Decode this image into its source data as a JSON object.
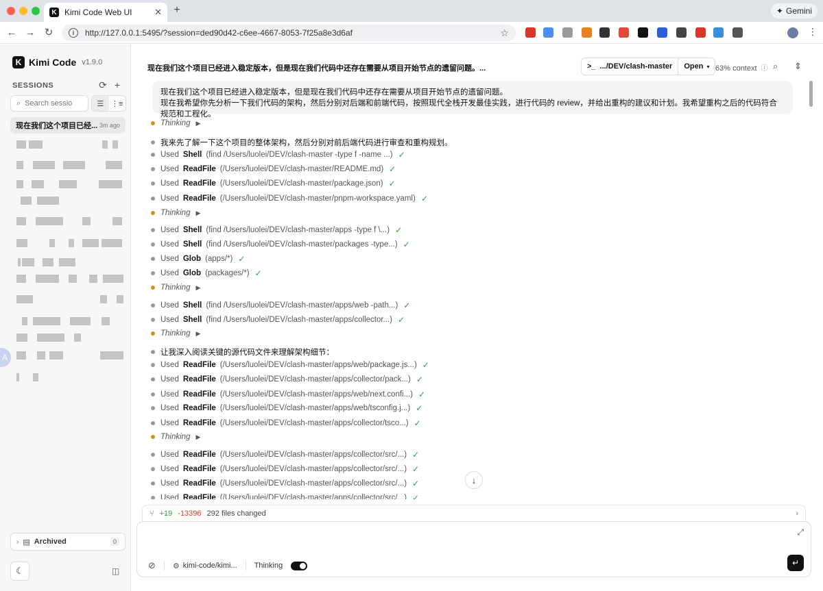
{
  "browser": {
    "tab_title": "Kimi Code Web UI",
    "tab_favicon": "K",
    "new_tab": "+",
    "gemini_label": "Gemini",
    "url": "http://127.0.0.1:5495/?session=ded90d42-c6ee-4667-8053-7f25a8e3d6af",
    "extension_colors": [
      "#d9362b",
      "#4a8ef0",
      "#9a9a9a",
      "#e8821e",
      "#333333",
      "#e04a3a",
      "#111111",
      "#2f5fd6",
      "#444444",
      "#d9362b",
      "#3a8fd9",
      "#555555"
    ]
  },
  "sidebar": {
    "brand_logo": "K",
    "brand_name": "Kimi Code",
    "version": "v1.9.0",
    "sessions_label": "SESSIONS",
    "search_placeholder": "Search sessio",
    "active_session": {
      "title": "现在我们这个项目已经...",
      "time": "3m ago"
    },
    "avatar_letter": "A",
    "archived_label": "Archived",
    "archived_count": "0"
  },
  "main": {
    "title": "现在我们这个项目已经进入稳定版本，但是现在我们代码中还存在需要从项目开始节点的遗留问题。...",
    "cwd": ".../DEV/clash-master",
    "open_label": "Open",
    "context": "63% context",
    "user_message": [
      "现在我们这个项目已经进入稳定版本，但是现在我们代码中还存在需要从项目开始节点的遗留问题。",
      "现在我希望你先分析一下我们代码的架构，然后分别对后端和前端代码，按照现代全栈开发最佳实践，进行代码的 review，并给出重构的建议和计划。我希望重构之后的代码符合规范和工程化。"
    ],
    "thinking_label": "Thinking",
    "used_label": "Used",
    "steps": [
      {
        "kind": "thinking"
      },
      {
        "kind": "say",
        "text": "我来先了解一下这个项目的整体架构，然后分别对前后端代码进行审查和重构规划。"
      },
      {
        "kind": "tool",
        "tool": "Shell",
        "args": "(find /Users/luolei/DEV/clash-master -type f -name ...)"
      },
      {
        "kind": "tool",
        "tool": "ReadFile",
        "args": "(/Users/luolei/DEV/clash-master/README.md)"
      },
      {
        "kind": "tool",
        "tool": "ReadFile",
        "args": "(/Users/luolei/DEV/clash-master/package.json)"
      },
      {
        "kind": "tool",
        "tool": "ReadFile",
        "args": "(/Users/luolei/DEV/clash-master/pnpm-workspace.yaml)"
      },
      {
        "kind": "thinking"
      },
      {
        "kind": "tool",
        "tool": "Shell",
        "args": "(find /Users/luolei/DEV/clash-master/apps -type f \\...)"
      },
      {
        "kind": "tool",
        "tool": "Shell",
        "args": "(find /Users/luolei/DEV/clash-master/packages -type...)"
      },
      {
        "kind": "tool",
        "tool": "Glob",
        "args": "(apps/*)"
      },
      {
        "kind": "tool",
        "tool": "Glob",
        "args": "(packages/*)"
      },
      {
        "kind": "thinking"
      },
      {
        "kind": "tool",
        "tool": "Shell",
        "args": "(find /Users/luolei/DEV/clash-master/apps/web -path...)"
      },
      {
        "kind": "tool",
        "tool": "Shell",
        "args": "(find /Users/luolei/DEV/clash-master/apps/collector...)"
      },
      {
        "kind": "thinking"
      },
      {
        "kind": "say",
        "text": "让我深入阅读关键的源代码文件来理解架构细节："
      },
      {
        "kind": "tool",
        "tool": "ReadFile",
        "args": "(/Users/luolei/DEV/clash-master/apps/web/package.js...)"
      },
      {
        "kind": "tool",
        "tool": "ReadFile",
        "args": "(/Users/luolei/DEV/clash-master/apps/collector/pack...)"
      },
      {
        "kind": "tool",
        "tool": "ReadFile",
        "args": "(/Users/luolei/DEV/clash-master/apps/web/next.confi...)"
      },
      {
        "kind": "tool",
        "tool": "ReadFile",
        "args": "(/Users/luolei/DEV/clash-master/apps/web/tsconfig.j...)"
      },
      {
        "kind": "tool",
        "tool": "ReadFile",
        "args": "(/Users/luolei/DEV/clash-master/apps/collector/tsco...)"
      },
      {
        "kind": "thinking"
      },
      {
        "kind": "tool",
        "tool": "ReadFile",
        "args": "(/Users/luolei/DEV/clash-master/apps/collector/src/...)"
      },
      {
        "kind": "tool",
        "tool": "ReadFile",
        "args": "(/Users/luolei/DEV/clash-master/apps/collector/src/...)"
      },
      {
        "kind": "tool",
        "tool": "ReadFile",
        "args": "(/Users/luolei/DEV/clash-master/apps/collector/src/...)"
      },
      {
        "kind": "tool",
        "tool": "ReadFile",
        "args": "(/Users/luolei/DEV/clash-master/apps/collector/src/...)"
      }
    ],
    "changes": {
      "added": "+19",
      "removed": "-13396",
      "files": "292 files changed"
    },
    "composer": {
      "model": "kimi-code/kimi...",
      "thinking_label": "Thinking",
      "thinking_on": true
    }
  },
  "colors": {
    "check": "#2e9e3e",
    "thinking_dot": "#c9961c",
    "removed": "#d43a2e"
  }
}
